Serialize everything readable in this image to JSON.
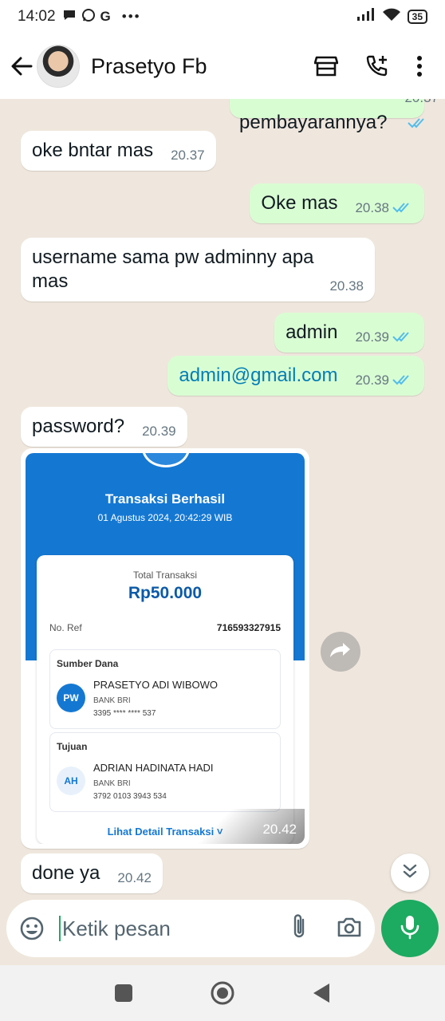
{
  "status_bar": {
    "time": "14:02",
    "notification_icons": [
      "chat-icon",
      "whatsapp-icon",
      "google-icon",
      "more-icon"
    ],
    "battery": "35"
  },
  "header": {
    "contact_name": "Prasetyo Fb"
  },
  "messages": [
    {
      "direction": "out",
      "text": "pembayarannya?",
      "time": "20.37",
      "read": true
    },
    {
      "direction": "in",
      "text": "oke bntar mas",
      "time": "20.37"
    },
    {
      "direction": "out",
      "text": "Oke mas",
      "time": "20.38",
      "read": true
    },
    {
      "direction": "in",
      "text_line1": "username sama pw adminny apa",
      "text_line2": "mas",
      "time": "20.38"
    },
    {
      "direction": "out",
      "text": "admin",
      "time": "20.39",
      "read": true
    },
    {
      "direction": "out",
      "text": "admin@gmail.com",
      "time": "20.39",
      "read": true
    },
    {
      "direction": "in",
      "text": "password?",
      "time": "20.39"
    },
    {
      "direction": "in",
      "type": "image",
      "time": "20.42"
    },
    {
      "direction": "in",
      "text": "done ya",
      "time": "20.42"
    }
  ],
  "receipt": {
    "title": "Transaksi Berhasil",
    "date": "01 Agustus 2024, 20:42:29 WIB",
    "total_label": "Total Transaksi",
    "total_value": "Rp50.000",
    "ref_label": "No. Ref",
    "ref_value": "716593327915",
    "source_label": "Sumber Dana",
    "source_initials": "PW",
    "source_name": "PRASETYO ADI WIBOWO",
    "source_bank": "BANK BRI",
    "source_account": "3395 **** **** 537",
    "dest_label": "Tujuan",
    "dest_initials": "AH",
    "dest_name": "ADRIAN HADINATA HADI",
    "dest_bank": "BANK BRI",
    "dest_account": "3792 0103 3943 534",
    "detail_link": "Lihat Detail Transaksi ˅",
    "watermark": "BRI"
  },
  "composer": {
    "placeholder": "Ketik pesan"
  },
  "colors": {
    "accent_green": "#1daa61",
    "outgoing_bubble": "#d9fdd3",
    "read_ticks": "#53bdeb",
    "bri_blue": "#1478d3"
  }
}
